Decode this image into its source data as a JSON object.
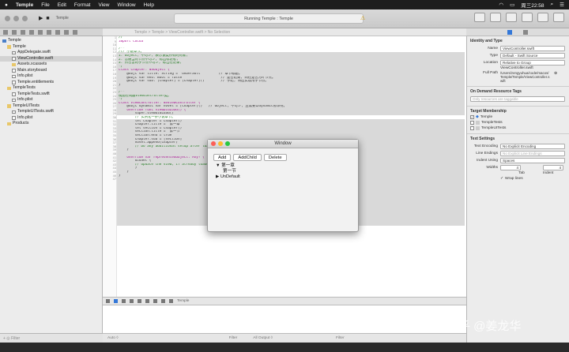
{
  "menubar": {
    "app": "Temple",
    "items": [
      "File",
      "Edit",
      "Format",
      "View",
      "Window",
      "Help"
    ],
    "clock": "周三22:58"
  },
  "toolbar": {
    "status": "Running Temple : Temple",
    "scheme": "Temple"
  },
  "navigator": {
    "items": [
      {
        "label": "Temple",
        "indent": 0,
        "kind": "proj"
      },
      {
        "label": "Temple",
        "indent": 1,
        "kind": "folder"
      },
      {
        "label": "AppDelegate.swift",
        "indent": 2,
        "kind": "file"
      },
      {
        "label": "ViewController.swift",
        "indent": 2,
        "kind": "file",
        "selected": true
      },
      {
        "label": "Assets.xcassets",
        "indent": 2,
        "kind": "folder"
      },
      {
        "label": "Main.storyboard",
        "indent": 2,
        "kind": "file"
      },
      {
        "label": "Info.plist",
        "indent": 2,
        "kind": "file"
      },
      {
        "label": "Temple.entitlements",
        "indent": 2,
        "kind": "file"
      },
      {
        "label": "TempleTests",
        "indent": 1,
        "kind": "folder"
      },
      {
        "label": "TempleTests.swift",
        "indent": 2,
        "kind": "file"
      },
      {
        "label": "Info.plist",
        "indent": 2,
        "kind": "file"
      },
      {
        "label": "TempleUITests",
        "indent": 1,
        "kind": "folder"
      },
      {
        "label": "TempleUITests.swift",
        "indent": 2,
        "kind": "file"
      },
      {
        "label": "Info.plist",
        "indent": 2,
        "kind": "file"
      },
      {
        "label": "Products",
        "indent": 1,
        "kind": "folder"
      }
    ],
    "filter": "Filter"
  },
  "jumpbar": "Temple  >  Temple  >  ViewController.swift  >  No Selection",
  "code": {
    "lines": [
      {
        "n": "1",
        "t": "//",
        "c": "cm"
      },
      {
        "n": "9",
        "t": "import Cocoa",
        "c": "kw"
      },
      {
        "n": "10",
        "t": "",
        "c": ""
      },
      {
        "n": "11",
        "t": "/**",
        "c": "cm"
      },
      {
        "n": "12",
        "t": "/// 小说章节。",
        "c": "cm"
      },
      {
        "n": "13",
        "t": "1. Object, 不可少, 表示该类所有的对象;",
        "c": "cm"
      },
      {
        "n": "14",
        "t": "2. 普通当对节点不可少, 标出标记者;",
        "c": "cm"
      },
      {
        "n": "15",
        "t": "3. 所包含的子节点不可少, 标出在记录;",
        "c": "cm"
      },
      {
        "n": "16",
        "t": "*/",
        "c": "cm"
      },
      {
        "n": "17",
        "t": "class Chapter: NSObject {",
        "c": "kw"
      },
      {
        "n": "18",
        "t": "    @objc var title: String = \"UnDefault\"        // 章节标题。",
        "c": ""
      },
      {
        "n": "19",
        "t": "    @objc var end: Bool = false                   // 是否结束, 同在是否为叶节点。",
        "c": ""
      },
      {
        "n": "20",
        "t": "    @objc var sub: [Chapter] = [Chapter]()        // 子结, 将应实现用子节点。",
        "c": ""
      },
      {
        "n": "21",
        "t": "}",
        "c": ""
      },
      {
        "n": "22",
        "t": "",
        "c": ""
      },
      {
        "n": "23",
        "t": "/**",
        "c": "cm"
      },
      {
        "n": "24",
        "t": "视图控制器ViewController类。",
        "c": "cm"
      },
      {
        "n": "25",
        "t": "*/",
        "c": "cm"
      },
      {
        "n": "26",
        "t": "class ViewController: NSViewController {",
        "c": "kw"
      },
      {
        "n": "27",
        "t": "    @objc dynamic var novel = [Chapter]()   // Object, 不可少, 且需要以dynamic修饰符。",
        "c": ""
      },
      {
        "n": "28",
        "t": "    override func viewDidLoad() {",
        "c": "kw"
      },
      {
        "n": "29",
        "t": "        super.viewDidLoad()",
        "c": ""
      },
      {
        "n": "30",
        "t": "        // 实例化一条小说章节。",
        "c": "cm"
      },
      {
        "n": "31",
        "t": "        let chapter = Chapter()",
        "c": ""
      },
      {
        "n": "32",
        "t": "        chapter.title = \"第一章\"",
        "c": ""
      },
      {
        "n": "33",
        "t": "        let section = Chapter()",
        "c": ""
      },
      {
        "n": "34",
        "t": "        section.title = \"第一节\"",
        "c": ""
      },
      {
        "n": "35",
        "t": "        section.end = true",
        "c": ""
      },
      {
        "n": "36",
        "t": "        chapter.sub = [section]",
        "c": ""
      },
      {
        "n": "37",
        "t": "        novel.append(chapter)",
        "c": ""
      },
      {
        "n": "38",
        "t": "        // Do any additional setup after loading the view.",
        "c": "cm"
      },
      {
        "n": "39",
        "t": "    }",
        "c": ""
      },
      {
        "n": "40",
        "t": "",
        "c": ""
      },
      {
        "n": "41",
        "t": "    override var representedObject: Any? {",
        "c": "kw"
      },
      {
        "n": "42",
        "t": "        didSet {",
        "c": ""
      },
      {
        "n": "43",
        "t": "        // Update the view, if already loaded.",
        "c": "cm"
      },
      {
        "n": "44",
        "t": "        }",
        "c": ""
      },
      {
        "n": "45",
        "t": "    }",
        "c": ""
      },
      {
        "n": "46",
        "t": "}",
        "c": ""
      },
      {
        "n": "47",
        "t": "",
        "c": ""
      }
    ]
  },
  "debug": {
    "target": "Temple"
  },
  "console": {
    "left": "Auto ◊",
    "filter": "Filter",
    "output": "All Output ◊",
    "filter2": "Filter"
  },
  "inspector": {
    "identity_title": "Identity and Type",
    "name_label": "Name",
    "name_value": "ViewController.swift",
    "type_label": "Type",
    "type_value": "Default - Swift Source",
    "location_label": "Location",
    "location_value": "Relative to Group",
    "location_file": "ViewController.swift",
    "fullpath_label": "Full Path",
    "fullpath_value": "/Users/zengyuhua/code/macos/Temple/Temple/ViewController.swift",
    "odr_title": "On Demand Resource Tags",
    "odr_placeholder": "Only resources are taggable",
    "membership_title": "Target Membership",
    "targets": [
      "Temple",
      "TempleTests",
      "TempleUITests"
    ],
    "text_title": "Text Settings",
    "encoding_label": "Text Encoding",
    "encoding_value": "No Explicit Encoding",
    "endings_label": "Line Endings",
    "endings_value": "No Explicit Line Endings",
    "indent_label": "Indent Using",
    "indent_value": "Spaces",
    "widths_label": "Widths",
    "tab_value": "4",
    "indent_value2": "4",
    "tab_label": "Tab",
    "indent_label2": "Indent",
    "wrap_label": "Wrap lines"
  },
  "dialog": {
    "title": "Window",
    "buttons": [
      "Add",
      "AddChild",
      "Delete"
    ],
    "tree": [
      {
        "label": "▼ 第一章",
        "indent": 0
      },
      {
        "label": "第一节",
        "indent": 1
      },
      {
        "label": "▶ UnDefault",
        "indent": 0
      }
    ]
  },
  "watermark": "知乎 @姜龙华"
}
